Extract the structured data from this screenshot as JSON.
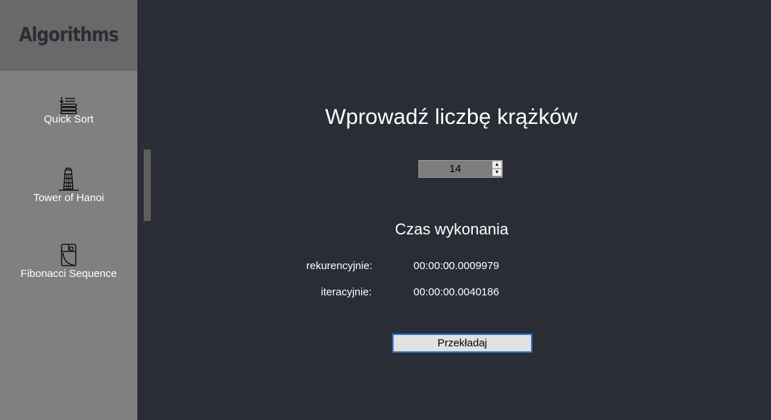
{
  "sidebar": {
    "title": "Algorithms",
    "items": [
      {
        "label": "Quick Sort",
        "icon": "sort-icon"
      },
      {
        "label": "Tower of Hanoi",
        "icon": "tower-icon"
      },
      {
        "label": "Fibonacci Sequence",
        "icon": "spiral-icon"
      }
    ]
  },
  "main": {
    "title": "Wprowadź liczbę krążków",
    "disk_count": "14",
    "section_title": "Czas wykonania",
    "rows": [
      {
        "label": "rekurencyjnie:",
        "value": "00:00:00.0009979"
      },
      {
        "label": "iteracyjnie:",
        "value": "00:00:00.0040186"
      }
    ],
    "button_label": "Przekładaj"
  },
  "colors": {
    "background": "#2a2d35",
    "sidebar": "#808080",
    "sidebar_header": "#696969",
    "accent": "#2a76d2"
  }
}
